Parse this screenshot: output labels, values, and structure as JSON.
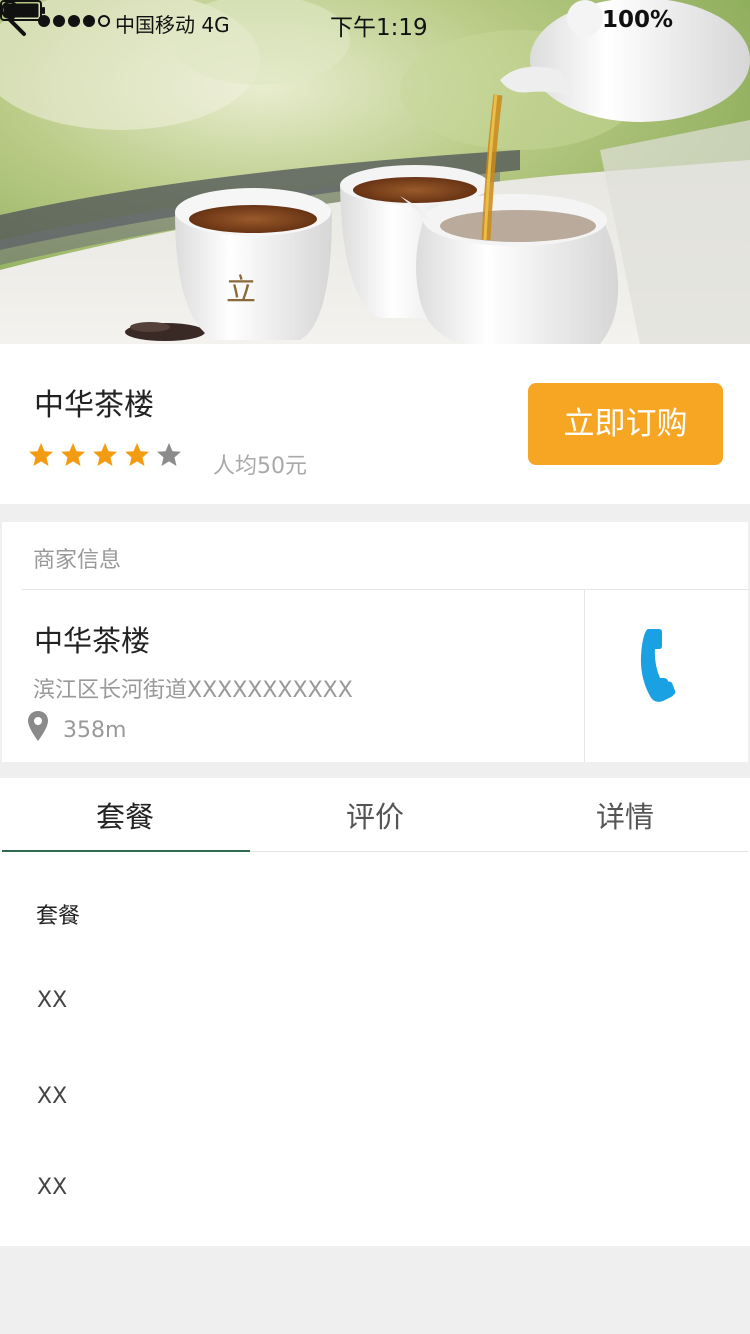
{
  "status_bar": {
    "carrier": "中国移动 4G",
    "time": "下午1:19",
    "battery": "100%"
  },
  "hero": {
    "icon": "back-chevron-icon",
    "image_subject": "tea-pouring-photo"
  },
  "shop": {
    "name": "中华茶楼",
    "rating": 4,
    "rating_max": 5,
    "avg_price": "人均50元",
    "order_button": "立即订购",
    "accent_color": "#f6a623",
    "star_active_color": "#f39c12",
    "star_inactive_color": "#8c8c8c"
  },
  "merchant": {
    "section_title": "商家信息",
    "name": "中华茶楼",
    "address": "滨江区长河街道XXXXXXXXXXX",
    "distance": "358m",
    "location_icon": "map-pin-icon",
    "phone_icon": "phone-icon",
    "phone_color": "#1aa1e3"
  },
  "tabs": [
    {
      "label": "套餐",
      "active": true
    },
    {
      "label": "评价",
      "active": false
    },
    {
      "label": "详情",
      "active": false
    }
  ],
  "package_list": {
    "heading": "套餐",
    "items": [
      "XX",
      "XX",
      "XX"
    ]
  }
}
